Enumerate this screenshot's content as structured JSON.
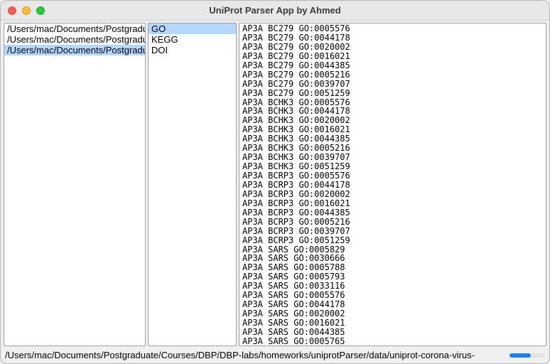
{
  "window": {
    "title": "UniProt Parser App by Ahmed"
  },
  "traffic": {
    "close": "close",
    "min": "minimize",
    "zoom": "zoom"
  },
  "file_list": {
    "items": [
      {
        "label": "/Users/mac/Documents/Postgraduate",
        "selected": false
      },
      {
        "label": "/Users/mac/Documents/Postgraduate",
        "selected": false
      },
      {
        "label": "/Users/mac/Documents/Postgraduate",
        "selected": true
      }
    ]
  },
  "filter_list": {
    "items": [
      {
        "label": "GO",
        "selected": true
      },
      {
        "label": "KEGG",
        "selected": false
      },
      {
        "label": "DOI",
        "selected": false
      }
    ]
  },
  "output": {
    "lines": [
      "AP3A_BC279   GO:0005576",
      "AP3A_BC279   GO:0044178",
      "AP3A_BC279   GO:0020002",
      "AP3A_BC279   GO:0016021",
      "AP3A_BC279   GO:0044385",
      "AP3A_BC279   GO:0005216",
      "AP3A_BC279   GO:0039707",
      "AP3A_BC279   GO:0051259",
      "AP3A_BCHK3   GO:0005576",
      "AP3A_BCHK3   GO:0044178",
      "AP3A_BCHK3   GO:0020002",
      "AP3A_BCHK3   GO:0016021",
      "AP3A_BCHK3   GO:0044385",
      "AP3A_BCHK3   GO:0005216",
      "AP3A_BCHK3   GO:0039707",
      "AP3A_BCHK3   GO:0051259",
      "AP3A_BCRP3   GO:0005576",
      "AP3A_BCRP3   GO:0044178",
      "AP3A_BCRP3   GO:0020002",
      "AP3A_BCRP3   GO:0016021",
      "AP3A_BCRP3   GO:0044385",
      "AP3A_BCRP3   GO:0005216",
      "AP3A_BCRP3   GO:0039707",
      "AP3A_BCRP3   GO:0051259",
      "AP3A_SARS   GO:0005829",
      "AP3A_SARS   GO:0030666",
      "AP3A_SARS   GO:0005788",
      "AP3A_SARS   GO:0005793",
      "AP3A_SARS   GO:0033116",
      "AP3A_SARS   GO:0005576",
      "AP3A_SARS   GO:0044178",
      "AP3A_SARS   GO:0020002",
      "AP3A_SARS   GO:0016021",
      "AP3A_SARS   GO:0044385",
      "AP3A_SARS   GO:0005765"
    ]
  },
  "status": {
    "text": "/Users/mac/Documents/Postgraduate/Courses/DBP/DBP-labs/homeworks/uniprotParser/data/uniprot-corona-virus-",
    "progress_percent": 60
  }
}
